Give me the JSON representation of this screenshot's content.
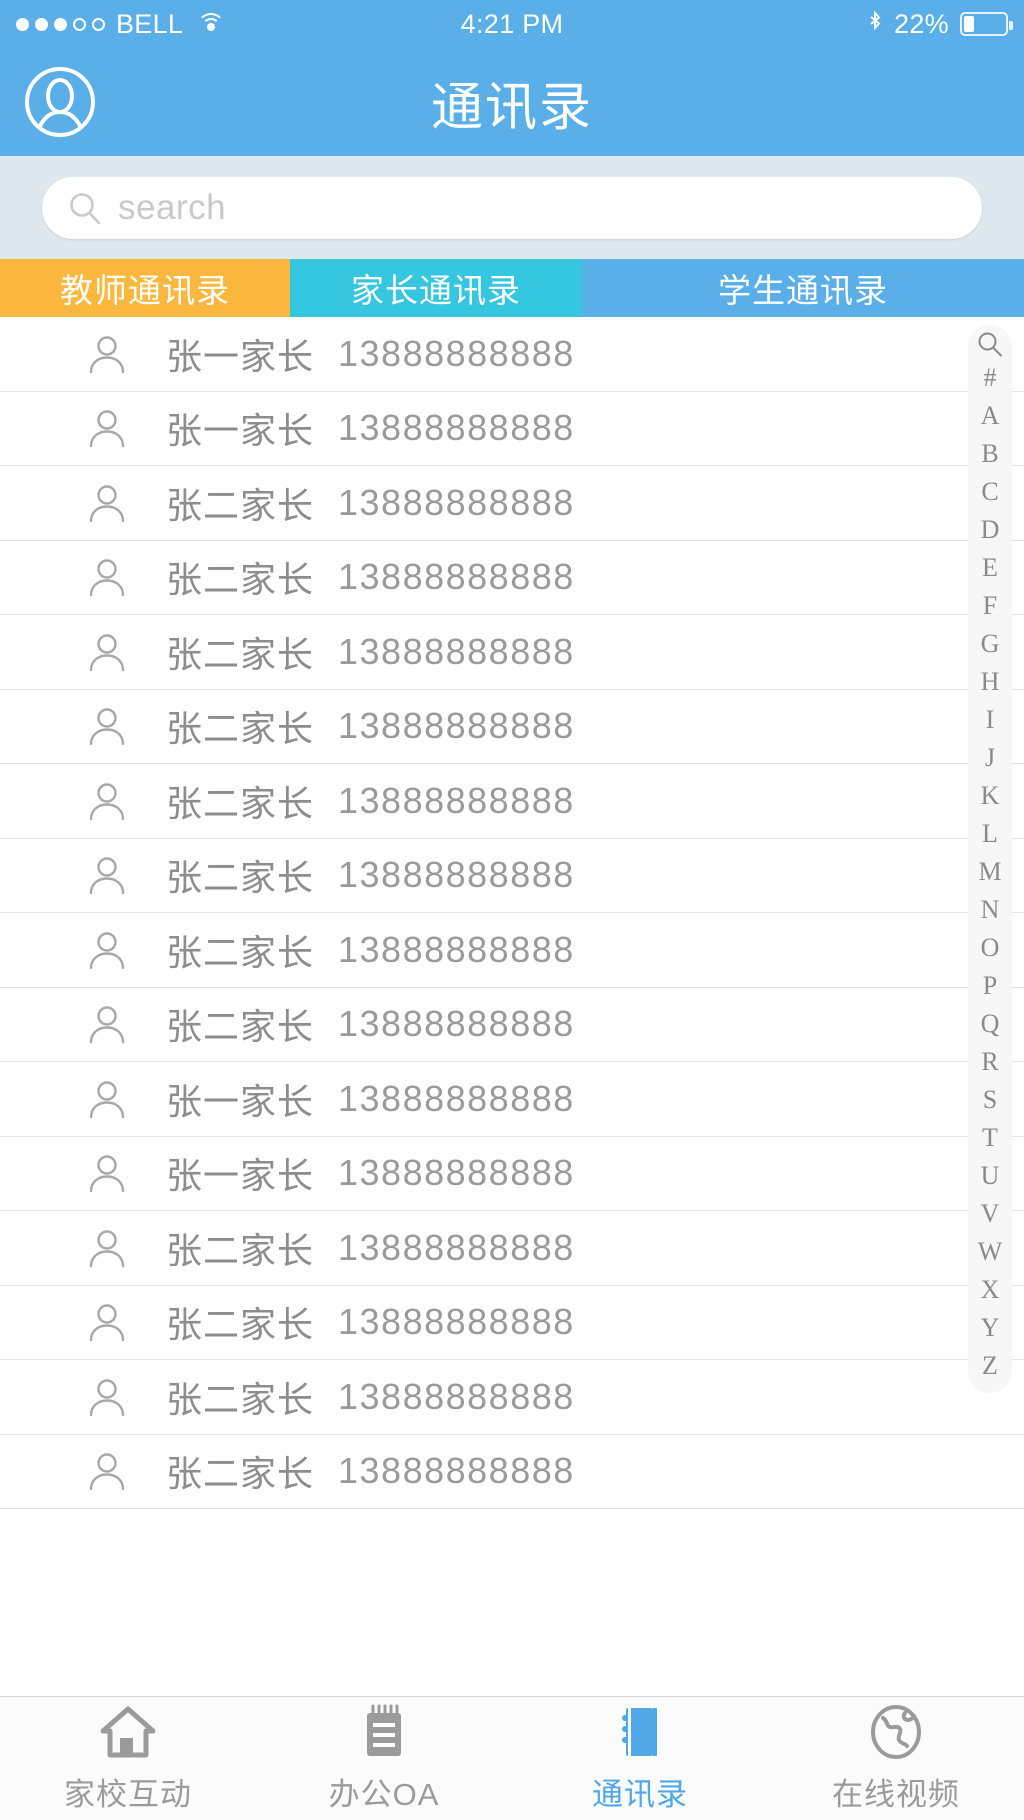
{
  "status_bar": {
    "signal_dots_filled": 3,
    "signal_dots_total": 5,
    "carrier": "BELL",
    "wifi_icon": "wifi-icon",
    "time": "4:21 PM",
    "bluetooth_icon": "bluetooth-icon",
    "battery_percent": "22%",
    "battery_level": 22
  },
  "header": {
    "avatar_icon": "user-avatar-icon",
    "title": "通讯录",
    "background_color": "#5aafe8"
  },
  "search": {
    "icon": "search-icon",
    "placeholder": "search",
    "value": ""
  },
  "tabs": [
    {
      "label": "教师通讯录",
      "color": "#fbb73e",
      "active": false
    },
    {
      "label": "家长通讯录",
      "color": "#35c6e0",
      "active": false
    },
    {
      "label": "学生通讯录",
      "color": "#5aafe8",
      "active": true
    }
  ],
  "contacts": [
    {
      "icon": "person-icon",
      "name": "张一家长",
      "phone": "13888888888"
    },
    {
      "icon": "person-icon",
      "name": "张一家长",
      "phone": "13888888888"
    },
    {
      "icon": "person-icon",
      "name": "张二家长",
      "phone": "13888888888"
    },
    {
      "icon": "person-icon",
      "name": "张二家长",
      "phone": "13888888888"
    },
    {
      "icon": "person-icon",
      "name": "张二家长",
      "phone": "13888888888"
    },
    {
      "icon": "person-icon",
      "name": "张二家长",
      "phone": "13888888888"
    },
    {
      "icon": "person-icon",
      "name": "张二家长",
      "phone": "13888888888"
    },
    {
      "icon": "person-icon",
      "name": "张二家长",
      "phone": "13888888888"
    },
    {
      "icon": "person-icon",
      "name": "张二家长",
      "phone": "13888888888"
    },
    {
      "icon": "person-icon",
      "name": "张二家长",
      "phone": "13888888888"
    },
    {
      "icon": "person-icon",
      "name": "张一家长",
      "phone": "13888888888"
    },
    {
      "icon": "person-icon",
      "name": "张一家长",
      "phone": "13888888888"
    },
    {
      "icon": "person-icon",
      "name": "张二家长",
      "phone": "13888888888"
    },
    {
      "icon": "person-icon",
      "name": "张二家长",
      "phone": "13888888888"
    },
    {
      "icon": "person-icon",
      "name": "张二家长",
      "phone": "13888888888"
    },
    {
      "icon": "person-icon",
      "name": "张二家长",
      "phone": "13888888888"
    }
  ],
  "alpha_index": {
    "search_icon": "search-icon",
    "letters": [
      "#",
      "A",
      "B",
      "C",
      "D",
      "E",
      "F",
      "G",
      "H",
      "I",
      "J",
      "K",
      "L",
      "M",
      "N",
      "O",
      "P",
      "Q",
      "R",
      "S",
      "T",
      "U",
      "V",
      "W",
      "X",
      "Y",
      "Z"
    ]
  },
  "bottom_nav": [
    {
      "icon": "home-icon",
      "label": "家校互动",
      "active": false
    },
    {
      "icon": "notepad-icon",
      "label": "办公OA",
      "active": false
    },
    {
      "icon": "addressbook-icon",
      "label": "通讯录",
      "active": true
    },
    {
      "icon": "globe-icon",
      "label": "在线视频",
      "active": false
    }
  ],
  "colors": {
    "brand_blue": "#5aafe8",
    "tab_orange": "#fbb73e",
    "tab_cyan": "#35c6e0",
    "active_nav": "#50a8e8",
    "search_bg": "#dfe8ee"
  }
}
